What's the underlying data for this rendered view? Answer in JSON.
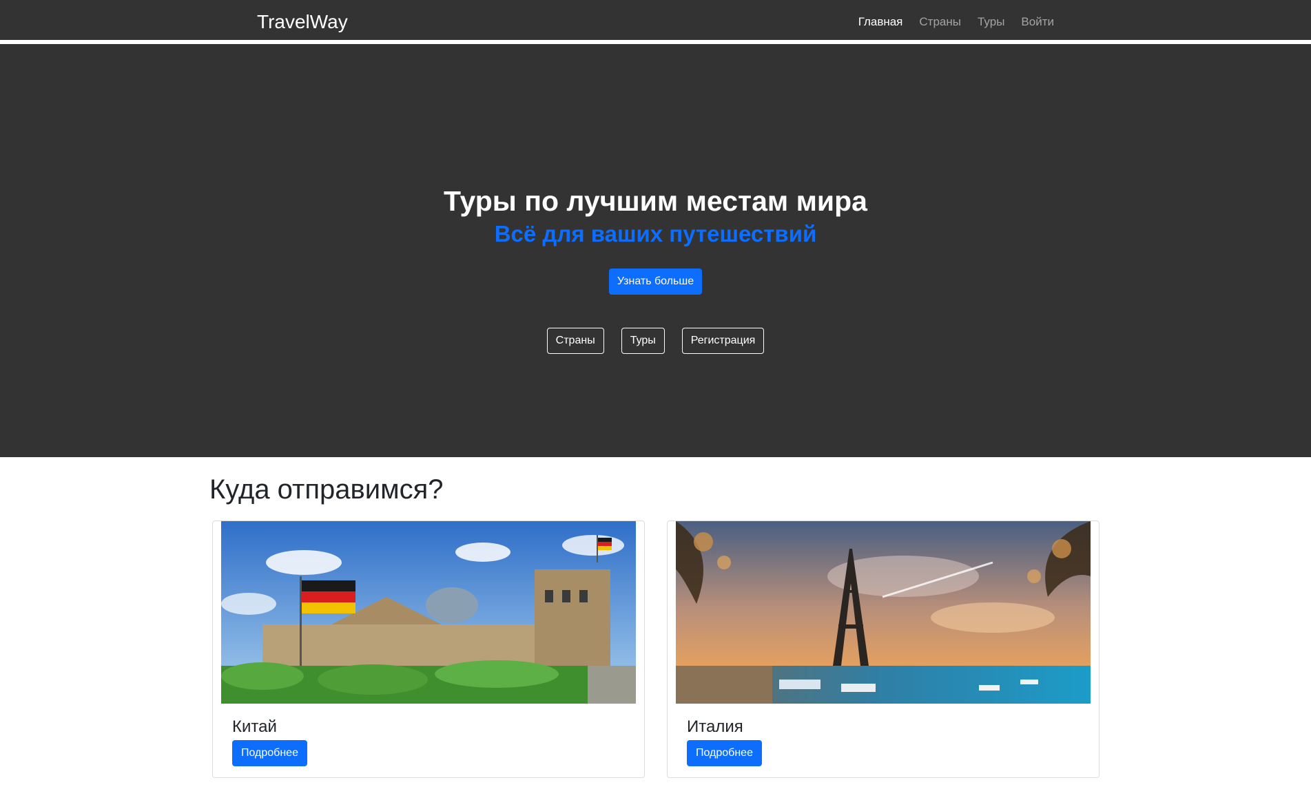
{
  "nav": {
    "brand": "TravelWay",
    "links": [
      "Главная",
      "Страны",
      "Туры",
      "Войти"
    ]
  },
  "hero": {
    "title": "Туры по лучшим местам мира",
    "subtitle": "Всё для ваших путешествий",
    "cta": "Узнать больше",
    "links": [
      "Страны",
      "Туры",
      "Регистрация"
    ]
  },
  "destinations": {
    "title": "Куда отправимся?",
    "cards": [
      {
        "title": "Китай",
        "button": "Подробнее"
      },
      {
        "title": "Италия",
        "button": "Подробнее"
      }
    ]
  },
  "colors": {
    "nav_bg": "#333333",
    "hero_bg": "#333333",
    "accent": "#0d6efd"
  }
}
